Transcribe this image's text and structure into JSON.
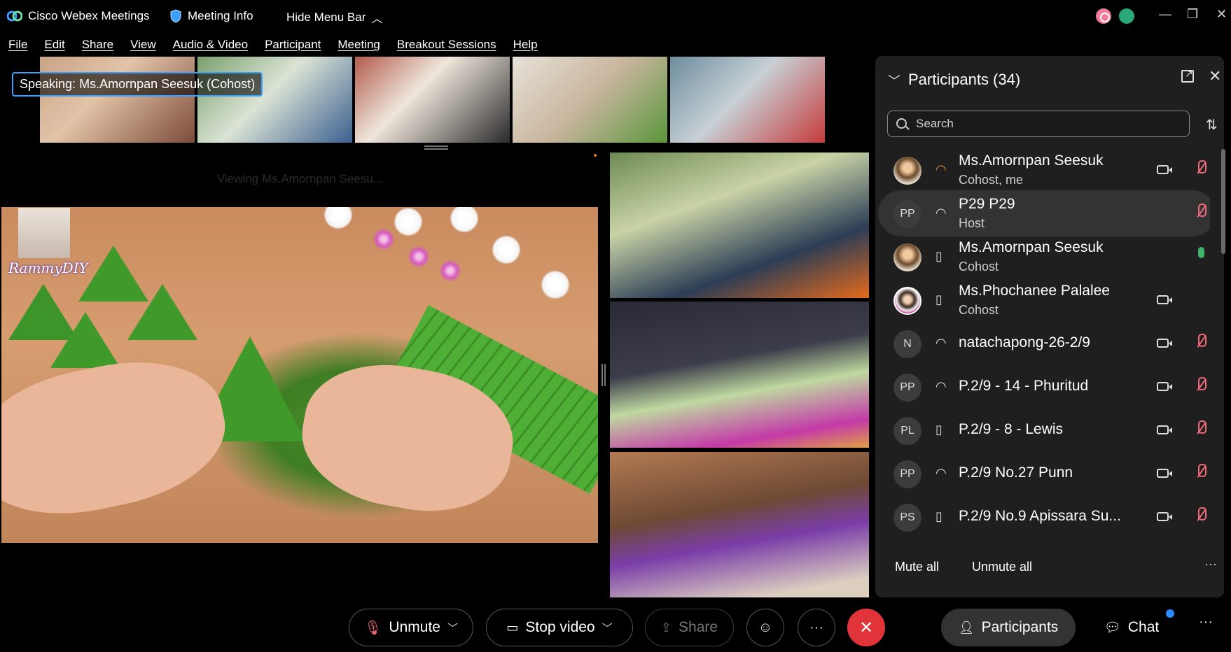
{
  "titlebar": {
    "app_name": "Cisco Webex Meetings",
    "meeting_info": "Meeting Info",
    "hide_menu_bar": "Hide Menu Bar"
  },
  "menu": [
    "File",
    "Edit",
    "Share",
    "View",
    "Audio & Video",
    "Participant",
    "Meeting",
    "Breakout Sessions",
    "Help"
  ],
  "speaking": {
    "label": "Speaking:",
    "name": "Ms.Amornpan Seesuk (Cohost)"
  },
  "stage": {
    "viewing": "Viewing Ms.Amornpan Seesu...",
    "brand_watermark": "RammyDIY"
  },
  "participants_panel": {
    "title": "Participants (34)",
    "search_placeholder": "Search",
    "participants": [
      {
        "initials": "",
        "name": "Ms.Amornpan Seesuk",
        "role": "Cohost, me",
        "device": "headset",
        "camera": true,
        "audio": "muted"
      },
      {
        "initials": "PP",
        "name": "P29 P29",
        "role": "Host",
        "device": "headset",
        "camera": false,
        "audio": "muted"
      },
      {
        "initials": "",
        "name": "Ms.Amornpan Seesuk",
        "role": "Cohost",
        "device": "phone",
        "camera": false,
        "audio": "on"
      },
      {
        "initials": "",
        "name": "Ms.Phochanee Palalee",
        "role": "Cohost",
        "device": "phone",
        "camera": true,
        "audio": "none"
      },
      {
        "initials": "N",
        "name": "natachapong-26-2/9",
        "role": "",
        "device": "headset",
        "camera": true,
        "audio": "muted"
      },
      {
        "initials": "PP",
        "name": "P.2/9 - 14 - Phuritud",
        "role": "",
        "device": "headset",
        "camera": true,
        "audio": "muted"
      },
      {
        "initials": "PL",
        "name": "P.2/9 - 8 - Lewis",
        "role": "",
        "device": "phone",
        "camera": true,
        "audio": "muted"
      },
      {
        "initials": "PP",
        "name": "P.2/9 No.27 Punn",
        "role": "",
        "device": "headset",
        "camera": true,
        "audio": "muted"
      },
      {
        "initials": "PS",
        "name": "P.2/9 No.9 Apissara Su...",
        "role": "",
        "device": "phone",
        "camera": true,
        "audio": "muted"
      }
    ],
    "mute_all": "Mute all",
    "unmute_all": "Unmute all"
  },
  "controls": {
    "unmute": "Unmute",
    "stop_video": "Stop video",
    "share": "Share",
    "participants": "Participants",
    "chat": "Chat"
  },
  "colors": {
    "accent_blue": "#3aa0ff",
    "end_red": "#e0343a",
    "muted_red": "#f06a7a",
    "mic_green": "#3fb36a",
    "panel_bg": "#1f1f1f"
  }
}
